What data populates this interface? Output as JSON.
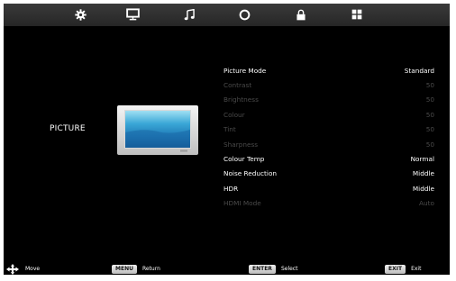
{
  "tabs": [
    {
      "icon": "gear-icon"
    },
    {
      "icon": "monitor-icon"
    },
    {
      "icon": "music-note-icon"
    },
    {
      "icon": "clock-icon"
    },
    {
      "icon": "lock-icon"
    },
    {
      "icon": "grid-icon"
    }
  ],
  "category": {
    "label": "PICTURE"
  },
  "settings": [
    {
      "label": "Picture Mode",
      "value": "Standard",
      "enabled": true
    },
    {
      "label": "Contrast",
      "value": "50",
      "enabled": false
    },
    {
      "label": "Brightness",
      "value": "50",
      "enabled": false
    },
    {
      "label": "Colour",
      "value": "50",
      "enabled": false
    },
    {
      "label": "Tint",
      "value": "50",
      "enabled": false
    },
    {
      "label": "Sharpness",
      "value": "50",
      "enabled": false
    },
    {
      "label": "Colour Temp",
      "value": "Normal",
      "enabled": true
    },
    {
      "label": "Noise Reduction",
      "value": "Middle",
      "enabled": true
    },
    {
      "label": "HDR",
      "value": "Middle",
      "enabled": true
    },
    {
      "label": "HDMI Mode",
      "value": "Auto",
      "enabled": false
    }
  ],
  "hints": {
    "move": {
      "label": "Move",
      "icon": "dpad-arrows-icon"
    },
    "return": {
      "key": "MENU",
      "label": "Return"
    },
    "select": {
      "key": "ENTER",
      "label": "Select"
    },
    "exit": {
      "key": "EXIT",
      "label": "Exit"
    }
  },
  "colors": {
    "background": "#000000",
    "tabbar": "#2e2e2e",
    "text_enabled": "#ffffff",
    "text_disabled": "#4a4a4a"
  }
}
